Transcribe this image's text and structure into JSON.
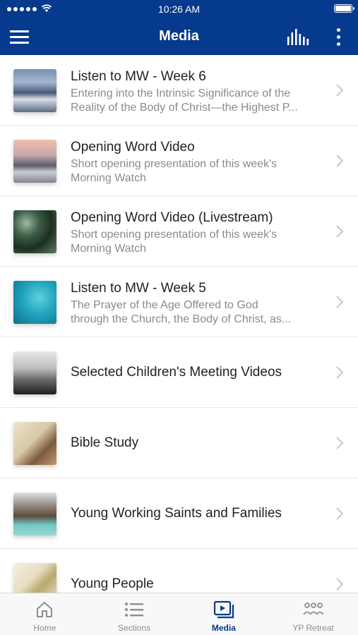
{
  "status": {
    "time": "10:26 AM"
  },
  "header": {
    "title": "Media"
  },
  "list": [
    {
      "title": "Listen to MW - Week 6",
      "sub": [
        "Entering into the Intrinsic Significance of the",
        "Reality of the Body of Christ—the Highest P..."
      ]
    },
    {
      "title": "Opening Word Video",
      "sub": [
        "Short opening presentation of this week's",
        "Morning Watch"
      ]
    },
    {
      "title": "Opening Word Video (Livestream)",
      "sub": [
        "Short opening presentation of this week's",
        "Morning Watch"
      ]
    },
    {
      "title": "Listen to MW - Week 5",
      "sub": [
        "The Prayer of the Age Offered to God",
        "through the Church, the Body of Christ, as..."
      ]
    },
    {
      "title": "Selected Children's Meeting Videos",
      "sub": []
    },
    {
      "title": "Bible Study",
      "sub": []
    },
    {
      "title": "Young Working Saints and Families",
      "sub": []
    },
    {
      "title": "Young People",
      "sub": []
    }
  ],
  "tabs": [
    {
      "label": "Home",
      "icon": "home-icon"
    },
    {
      "label": "Sections",
      "icon": "list-icon"
    },
    {
      "label": "Media",
      "icon": "video-icon",
      "active": true
    },
    {
      "label": "YP Retreat",
      "icon": "group-icon"
    }
  ],
  "colors": {
    "header_bg": "#063a8c",
    "active_tab": "#063a8c",
    "inactive_tab": "#8e8e8e"
  }
}
